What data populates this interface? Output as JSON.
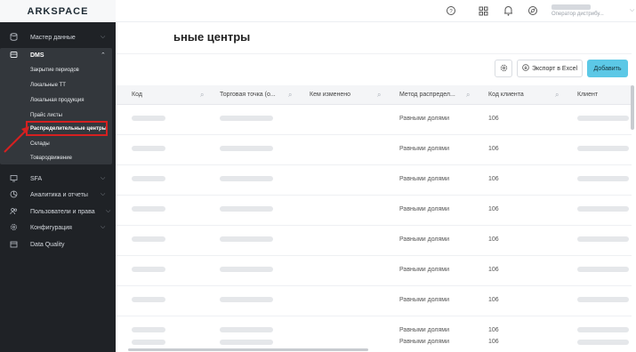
{
  "header": {
    "user_role": "Оператор дистрибу..."
  },
  "page": {
    "title": "ьные центры"
  },
  "toolbar": {
    "export_label": "Экспорт в Excel",
    "add_label": "Добавить"
  },
  "sidebar": {
    "logo": "ARKSPACE",
    "items": [
      {
        "label": "Мастер данные",
        "icon": "database-icon"
      },
      {
        "label": "DMS",
        "icon": "box-icon"
      },
      {
        "label": "SFA",
        "icon": "monitor-icon"
      },
      {
        "label": "Аналитика и отчеты",
        "icon": "chart-icon"
      },
      {
        "label": "Пользователи и права",
        "icon": "users-icon"
      },
      {
        "label": "Конфигурация",
        "icon": "settings-icon"
      },
      {
        "label": "Data Quality",
        "icon": "calendar-icon"
      }
    ],
    "dms_sub": [
      "Закрытие периодов",
      "Локальные ТТ",
      "Локальная продукция",
      "Прайс листы",
      "Распределительные центры",
      "Склады",
      "Товародвижение"
    ]
  },
  "table": {
    "columns": [
      "Код",
      "Торговая точка (о...",
      "Кем изменено",
      "Метод распредел...",
      "Код клиента",
      "Клиент"
    ],
    "rows": [
      {
        "method": "Равными долями",
        "client_code": "106"
      },
      {
        "method": "Равными долями",
        "client_code": "106"
      },
      {
        "method": "Равными долями",
        "client_code": "106"
      },
      {
        "method": "Равными долями",
        "client_code": "106"
      },
      {
        "method": "Равными долями",
        "client_code": "106"
      },
      {
        "method": "Равными долями",
        "client_code": "106"
      },
      {
        "method": "Равными долями",
        "client_code": "106"
      },
      {
        "method": "Равными долями",
        "client_code": "106"
      },
      {
        "method": "Равными долями",
        "client_code": "106"
      }
    ]
  }
}
